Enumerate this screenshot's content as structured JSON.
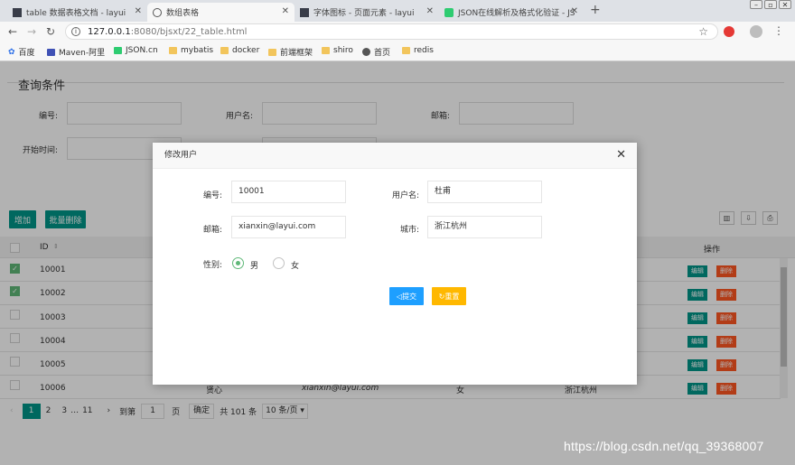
{
  "browser": {
    "tabs": [
      {
        "title": "table 数据表格文档 - layui",
        "icon": "layui-icon",
        "active": false
      },
      {
        "title": "数组表格",
        "icon": "globe-icon",
        "active": true
      },
      {
        "title": "字体图标 - 页面元素 - layui",
        "icon": "layui-icon",
        "active": false
      },
      {
        "title": "JSON在线解析及格式化验证 - JS",
        "icon": "json-icon",
        "active": false
      }
    ],
    "new_tab": "+",
    "url_host": "127.0.0.1",
    "url_path": ":8080/bjsxt/22_table.html",
    "bookmarks": [
      "百度",
      "Maven-阿里",
      "JSON.cn",
      "mybatis",
      "docker",
      "前端框架",
      "shiro",
      "首页",
      "redis"
    ]
  },
  "search_panel": {
    "title": "查询条件",
    "labels": {
      "id": "编号:",
      "username": "用户名:",
      "email": "邮箱:",
      "start_time": "开始时间:"
    }
  },
  "toolbar": {
    "add": "增加",
    "batch_delete": "批量删除"
  },
  "table": {
    "header_id": "ID",
    "header_action": "操作",
    "rows": [
      {
        "id": "10001",
        "checked": true
      },
      {
        "id": "10002",
        "checked": true
      },
      {
        "id": "10003",
        "checked": false
      },
      {
        "id": "10004",
        "checked": false
      },
      {
        "id": "10005",
        "checked": false
      },
      {
        "id": "10006",
        "checked": false,
        "name": "贤心",
        "email": "xianxin@layui.com",
        "sex": "女",
        "city": "浙江杭州"
      }
    ],
    "edit_label": "编辑",
    "delete_label": "删除"
  },
  "pager": {
    "pages": [
      "1",
      "2",
      "3",
      "…",
      "11"
    ],
    "goto_label": "到第",
    "goto_value": "1",
    "page_unit": "页",
    "confirm": "确定",
    "total": "共 101 条",
    "per_page": "10 条/页"
  },
  "modal": {
    "title": "修改用户",
    "close": "✕",
    "labels": {
      "id": "编号:",
      "username": "用户名:",
      "email": "邮箱:",
      "city": "城市:",
      "sex": "性别:"
    },
    "values": {
      "id": "10001",
      "username": "杜甫",
      "email": "xianxin@layui.com",
      "city": "浙江杭州"
    },
    "sex_options": [
      "男",
      "女"
    ],
    "sex_selected": "男",
    "submit": "提交",
    "reset": "重置"
  },
  "watermark": "https://blog.csdn.net/qq_39368007",
  "colors": {
    "primary": "#009688",
    "danger": "#ff5722",
    "normal": "#1e9fff",
    "warm": "#ffb800",
    "check": "#5fb878"
  }
}
